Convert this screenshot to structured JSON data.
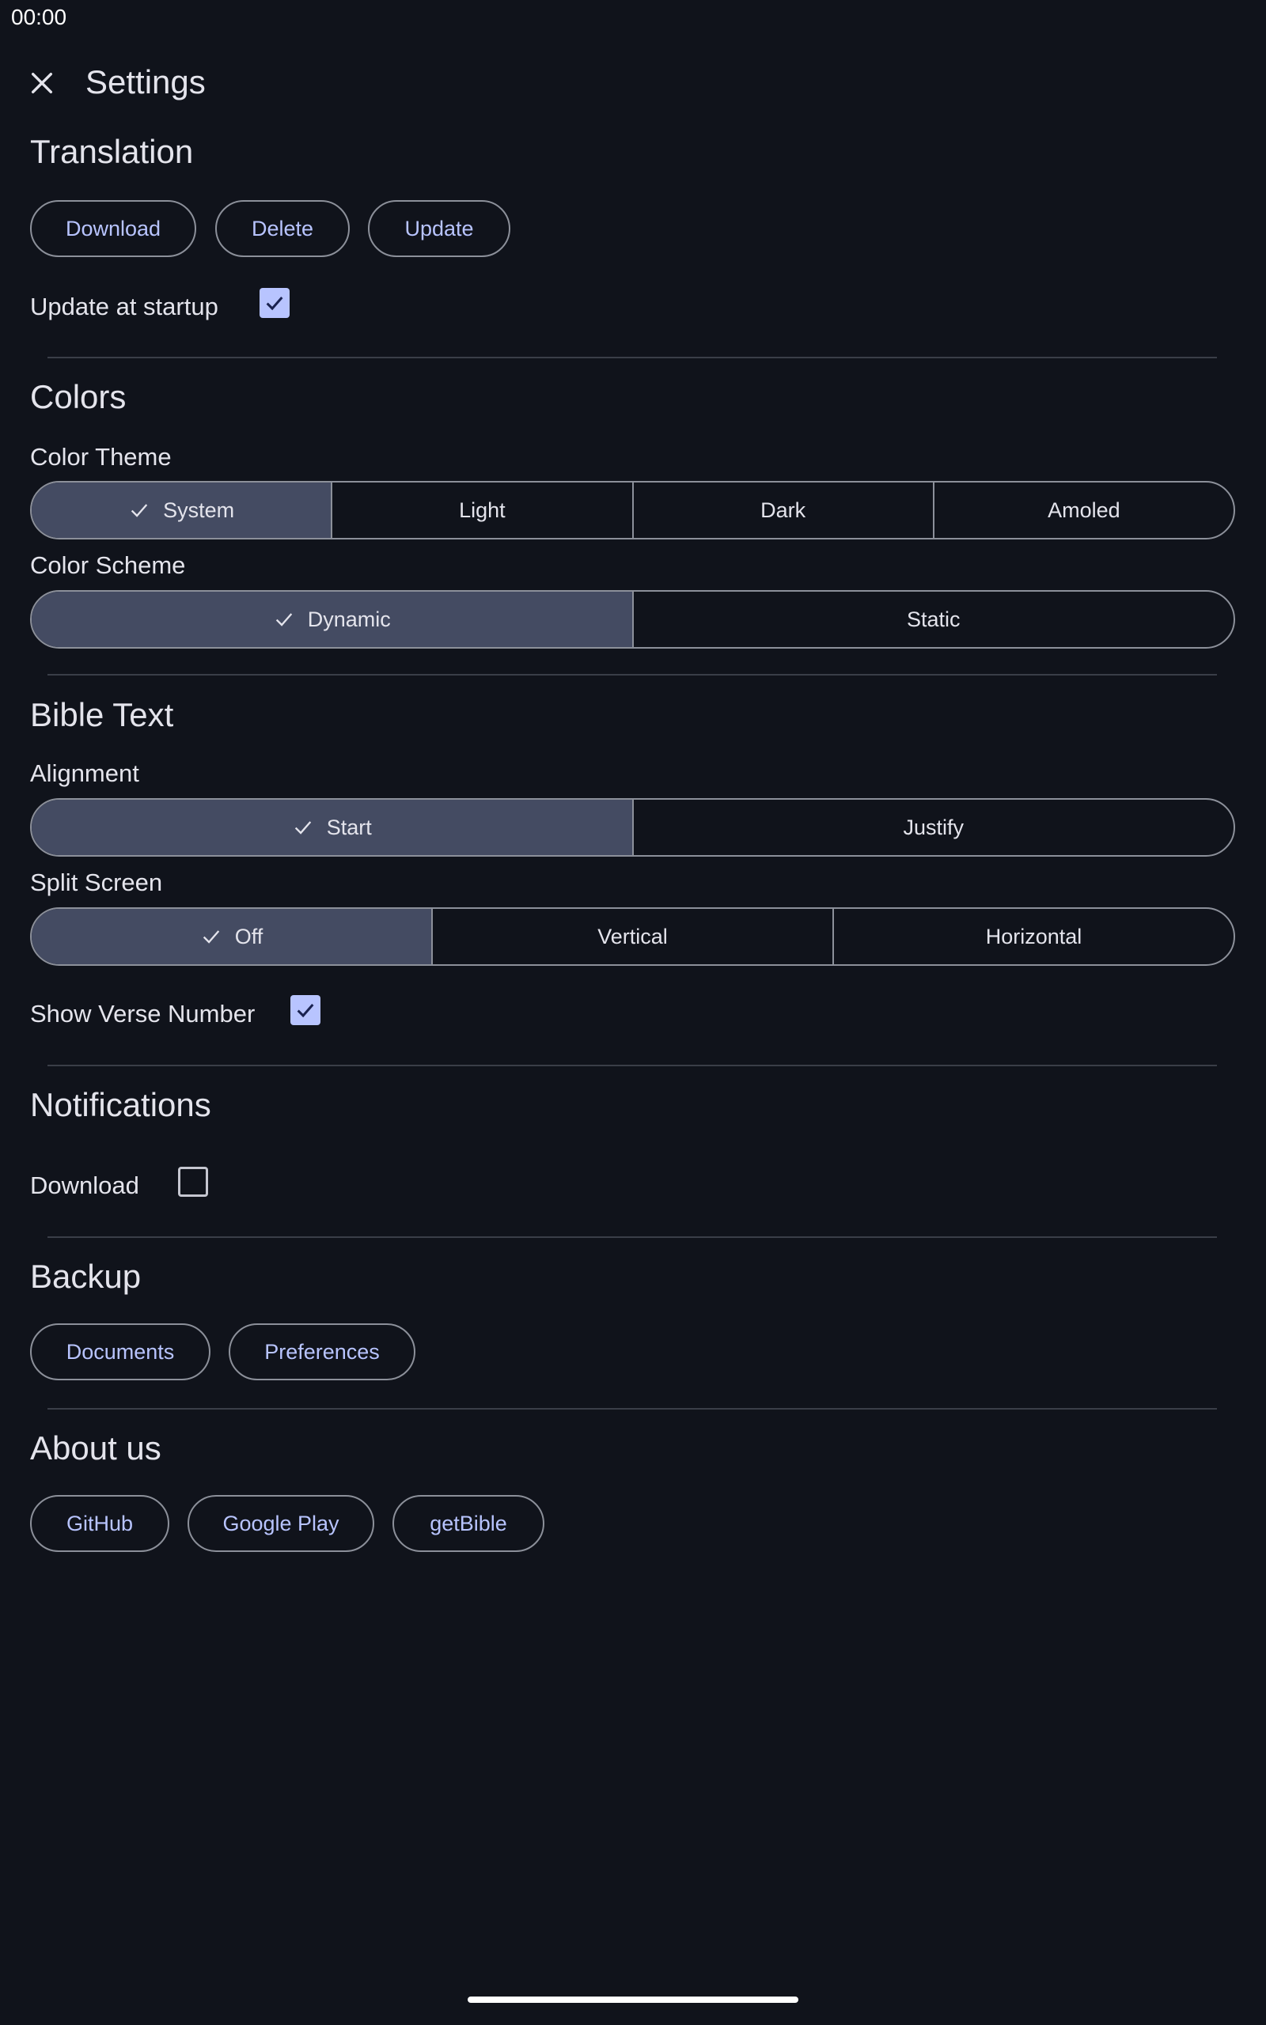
{
  "status_bar": {
    "time": "00:00"
  },
  "header": {
    "title": "Settings",
    "close_icon": "close-icon"
  },
  "translation": {
    "title": "Translation",
    "buttons": [
      "Download",
      "Delete",
      "Update"
    ],
    "update_at_startup": {
      "label": "Update at startup",
      "checked": true
    }
  },
  "colors": {
    "title": "Colors",
    "color_theme": {
      "label": "Color Theme",
      "options": [
        "System",
        "Light",
        "Dark",
        "Amoled"
      ],
      "selected": "System"
    },
    "color_scheme": {
      "label": "Color Scheme",
      "options": [
        "Dynamic",
        "Static"
      ],
      "selected": "Dynamic"
    }
  },
  "bible_text": {
    "title": "Bible Text",
    "alignment": {
      "label": "Alignment",
      "options": [
        "Start",
        "Justify"
      ],
      "selected": "Start"
    },
    "split_screen": {
      "label": "Split Screen",
      "options": [
        "Off",
        "Vertical",
        "Horizontal"
      ],
      "selected": "Off"
    },
    "show_verse_number": {
      "label": "Show Verse Number",
      "checked": true
    }
  },
  "notifications": {
    "title": "Notifications",
    "download": {
      "label": "Download",
      "checked": false
    }
  },
  "backup": {
    "title": "Backup",
    "buttons": [
      "Documents",
      "Preferences"
    ]
  },
  "about": {
    "title": "About us",
    "buttons": [
      "GitHub",
      "Google Play",
      "getBible"
    ]
  },
  "theme_colors": {
    "background": "#10131b",
    "accent": "#b8c4ff",
    "selected_segment": "#444b62",
    "outline": "#8c909a"
  }
}
